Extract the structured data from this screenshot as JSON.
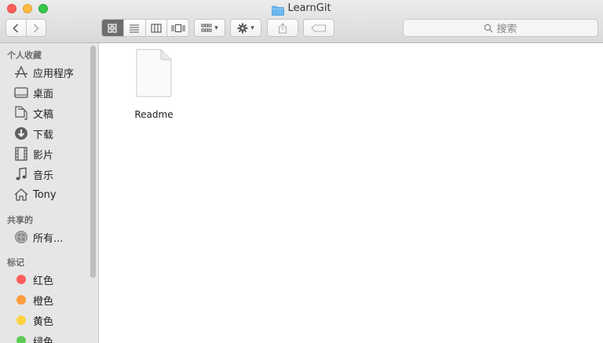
{
  "window": {
    "title": "LearnGit"
  },
  "toolbar": {
    "back_icon": "chevron-left",
    "forward_icon": "chevron-right",
    "view_modes": [
      "icon-view",
      "list-view",
      "column-view",
      "cover-flow-view"
    ],
    "group_icon": "group-by",
    "action_icon": "gear",
    "share_icon": "share",
    "tag_icon": "tag"
  },
  "search": {
    "placeholder": "搜索"
  },
  "sidebar": {
    "favorites_header": "个人收藏",
    "favorites": [
      {
        "label": "应用程序",
        "icon": "applications"
      },
      {
        "label": "桌面",
        "icon": "desktop"
      },
      {
        "label": "文稿",
        "icon": "documents"
      },
      {
        "label": "下载",
        "icon": "downloads"
      },
      {
        "label": "影片",
        "icon": "movies"
      },
      {
        "label": "音乐",
        "icon": "music"
      },
      {
        "label": "Tony",
        "icon": "home"
      }
    ],
    "shared_header": "共享的",
    "shared": [
      {
        "label": "所有...",
        "icon": "network"
      }
    ],
    "tags_header": "标记",
    "tags": [
      {
        "label": "红色",
        "color": "#fc605c"
      },
      {
        "label": "橙色",
        "color": "#fd9b3e"
      },
      {
        "label": "黄色",
        "color": "#fdd33e"
      },
      {
        "label": "绿色",
        "color": "#5fcb55"
      }
    ]
  },
  "files": [
    {
      "name": "Readme",
      "icon": "document"
    }
  ]
}
